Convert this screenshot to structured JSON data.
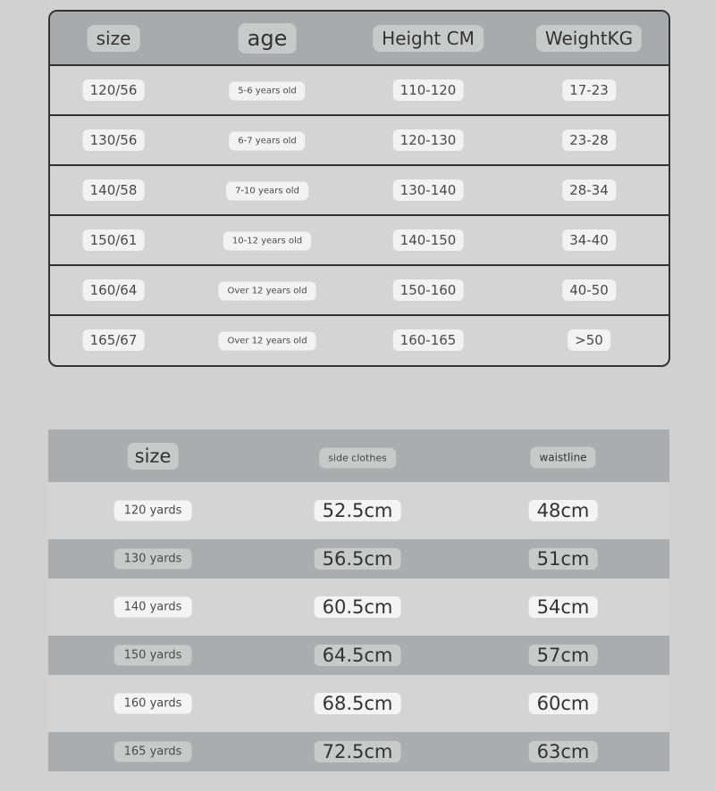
{
  "size_table": {
    "headers": [
      "size",
      "age",
      "Height CM",
      "WeightKG"
    ],
    "rows": [
      {
        "size": "120/56",
        "age": "5-6 years old",
        "height": "110-120",
        "weight": "17-23"
      },
      {
        "size": "130/56",
        "age": "6-7 years old",
        "height": "120-130",
        "weight": "23-28"
      },
      {
        "size": "140/58",
        "age": "7-10 years old",
        "height": "130-140",
        "weight": "28-34"
      },
      {
        "size": "150/61",
        "age": "10-12 years old",
        "height": "140-150",
        "weight": "34-40"
      },
      {
        "size": "160/64",
        "age": "Over 12 years old",
        "height": "150-160",
        "weight": "40-50"
      },
      {
        "size": "165/67",
        "age": "Over 12 years old",
        "height": "160-165",
        "weight": ">50"
      }
    ]
  },
  "measure_table": {
    "headers": [
      "size",
      "side clothes",
      "waistline"
    ],
    "rows": [
      {
        "size": "120 yards",
        "side": "52.5cm",
        "waist": "48cm"
      },
      {
        "size": "130 yards",
        "side": "56.5cm",
        "waist": "51cm"
      },
      {
        "size": "140 yards",
        "side": "60.5cm",
        "waist": "54cm"
      },
      {
        "size": "150 yards",
        "side": "64.5cm",
        "waist": "57cm"
      },
      {
        "size": "160 yards",
        "side": "68.5cm",
        "waist": "60cm"
      },
      {
        "size": "165 yards",
        "side": "72.5cm",
        "waist": "63cm"
      }
    ]
  }
}
